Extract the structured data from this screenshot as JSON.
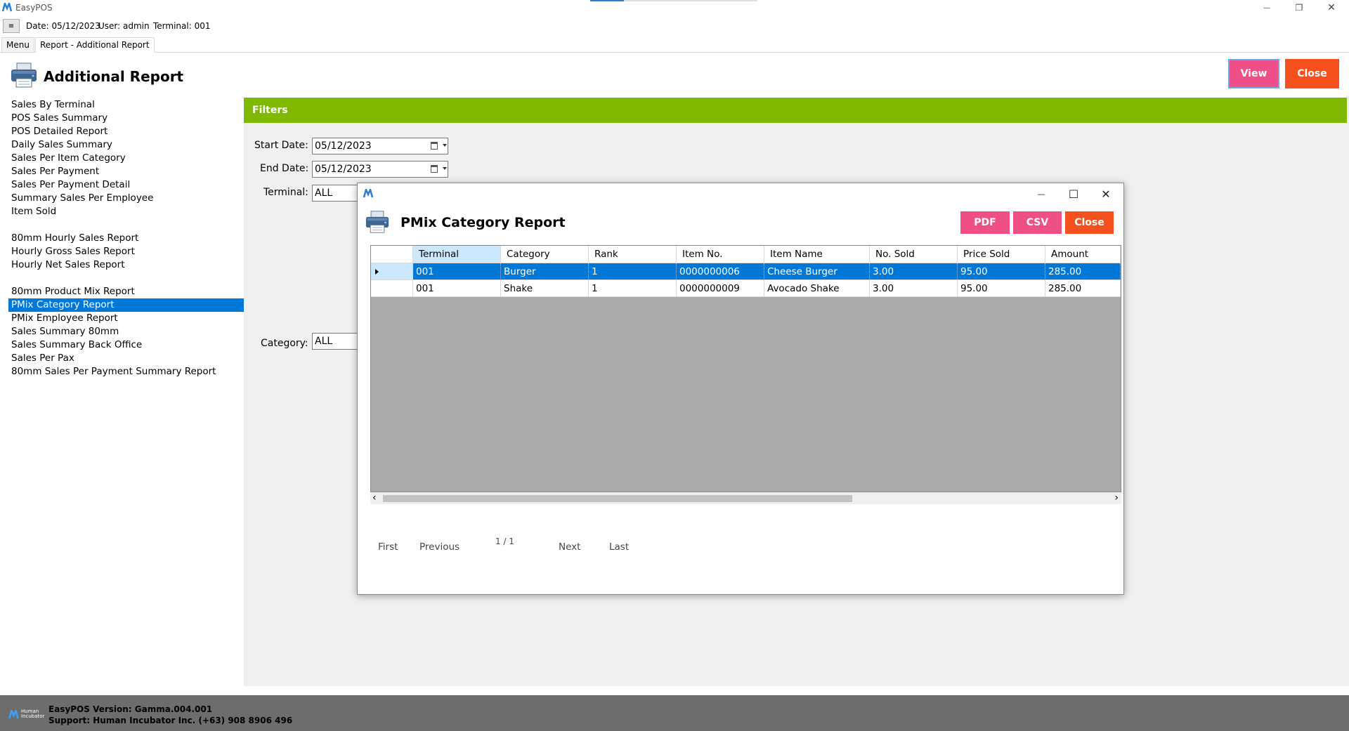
{
  "window": {
    "title": "EasyPOS",
    "minimize_glyph": "—",
    "restore_glyph": "❐",
    "close_glyph": "✕",
    "progress_fraction": 0.2
  },
  "infobar": {
    "menu_toggle": "≡",
    "date": "Date: 05/12/2023",
    "user": "User: admin",
    "terminal": "Terminal: 001"
  },
  "tabs": {
    "menu": "Menu",
    "report": "Report - Additional Report"
  },
  "header": {
    "title": "Additional Report",
    "view_label": "View",
    "close_label": "Close",
    "icon": "printer-icon"
  },
  "report_list": {
    "items": [
      "Sales By Terminal",
      "POS Sales Summary",
      "POS Detailed Report",
      "Daily Sales Summary",
      "Sales Per Item Category",
      "Sales Per Payment",
      "Sales Per Payment Detail",
      "Summary Sales Per Employee",
      "Item Sold",
      "80mm Hourly Sales Report",
      "Hourly Gross Sales Report",
      "Hourly Net Sales Report",
      "80mm Product Mix Report",
      "PMix Category Report",
      "PMix Employee Report",
      "Sales Summary 80mm",
      "Sales Summary Back Office",
      "Sales Per Pax",
      "80mm Sales Per Payment Summary Report"
    ],
    "selected": "PMix Category Report"
  },
  "filters": {
    "header": "Filters",
    "start_date_label": "Start Date:",
    "start_date_value": "05/12/2023",
    "end_date_label": "End Date:",
    "end_date_value": "05/12/2023",
    "terminal_label": "Terminal:",
    "terminal_value": "ALL",
    "category_label": "Category:",
    "category_value": "ALL"
  },
  "modal": {
    "title": "PMix Category Report",
    "pdf_label": "PDF",
    "csv_label": "CSV",
    "close_label": "Close",
    "minimize_glyph": "—",
    "maximize_glyph": "☐",
    "close_glyph": "✕",
    "columns": [
      "Terminal",
      "Category",
      "Rank",
      "Item No.",
      "Item Name",
      "No. Sold",
      "Price Sold",
      "Amount"
    ],
    "rows": [
      [
        "001",
        "Burger",
        "1",
        "0000000006",
        "Cheese Burger",
        "3.00",
        "95.00",
        "285.00"
      ],
      [
        "001",
        "Shake",
        "1",
        "0000000009",
        "Avocado Shake",
        "3.00",
        "95.00",
        "285.00"
      ]
    ],
    "selected_row": 0,
    "pager": {
      "first": "First",
      "previous": "Previous",
      "page": "1 / 1",
      "next": "Next",
      "last": "Last"
    },
    "scroll_left": "‹",
    "scroll_right": "›"
  },
  "status": {
    "version": "EasyPOS Version: Gamma.004.001",
    "support": "Support: Human Incubator Inc. (+63) 908 8906 496",
    "logo_text_1": "Human",
    "logo_text_2": "Incubator"
  },
  "colors": {
    "accent_pink": "#ee4f86",
    "accent_orange": "#f4511e",
    "filters_green": "#7fba00",
    "selection_blue": "#0078d7"
  }
}
